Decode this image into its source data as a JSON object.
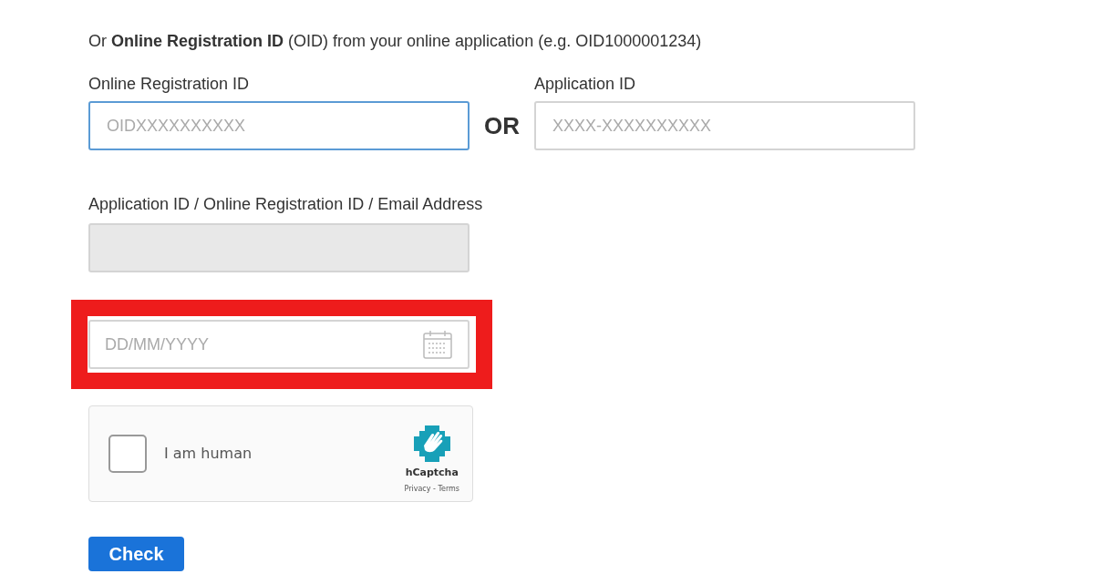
{
  "intro": [
    "Or **Online Registration ID** (OID) from your online application (e.g. OID1000001234)"
  ],
  "oid_field": {
    "label": "Online Registration ID",
    "placeholder": "OIDXXXXXXXXXX",
    "focused": true
  },
  "separator": "OR",
  "app_field": {
    "label": "Application ID",
    "placeholder": "XXXX-XXXXXXXXXX",
    "focused": false
  },
  "lookup_field": {
    "label": "Application ID / Online Registration ID / Email Address",
    "disabled": true
  },
  "dob_field": {
    "placeholder": "DD/MM/YYYY",
    "highlighted": true
  },
  "captcha": {
    "label": "I am human",
    "checked": false,
    "brand": "hCaptcha",
    "privacy": "Privacy",
    "dash": " - ",
    "terms": "Terms"
  },
  "submit": "Check"
}
